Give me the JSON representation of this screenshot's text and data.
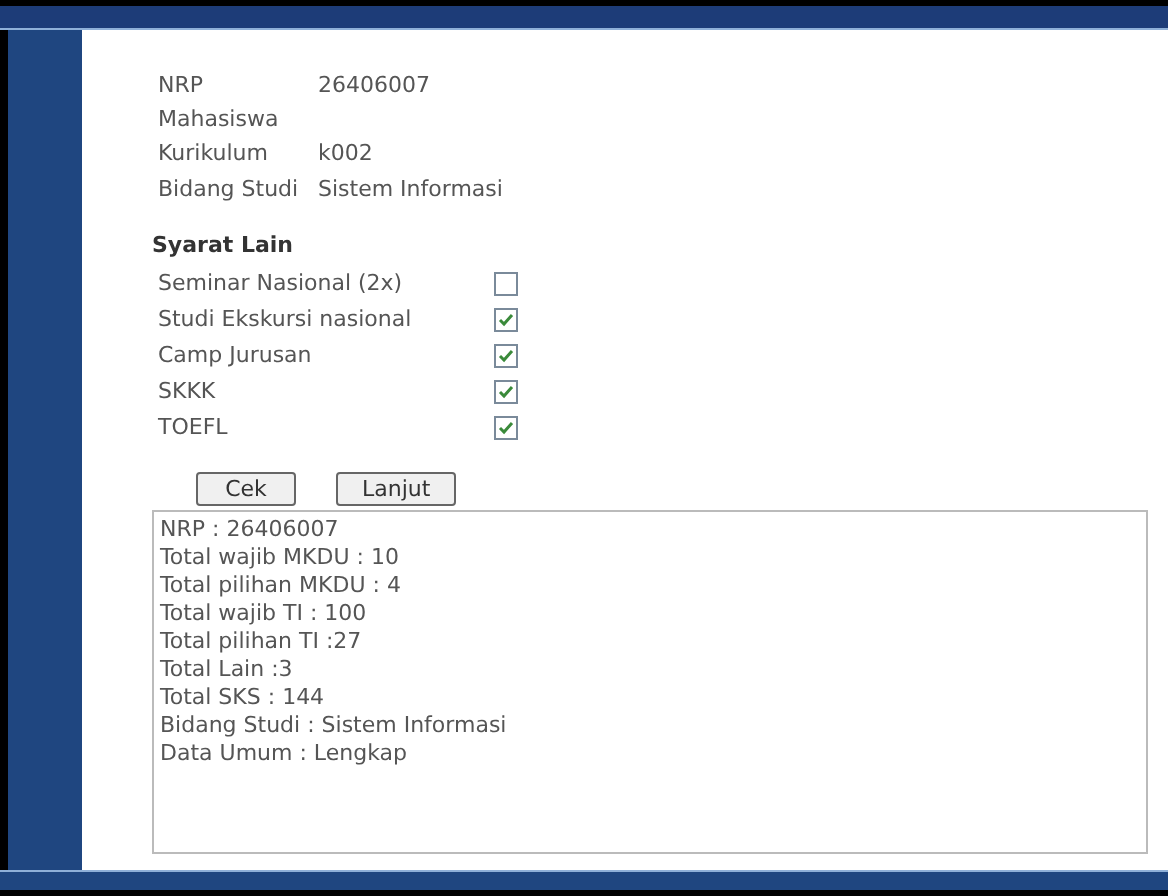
{
  "info": [
    {
      "label": "NRP Mahasiswa",
      "value": "26406007"
    },
    {
      "label": "Kurikulum",
      "value": "k002"
    },
    {
      "label": "Bidang Studi",
      "value": "Sistem Informasi"
    }
  ],
  "syarat": {
    "title": "Syarat Lain",
    "items": [
      {
        "label": "Seminar Nasional (2x)",
        "checked": false
      },
      {
        "label": "Studi Ekskursi nasional",
        "checked": true
      },
      {
        "label": "Camp Jurusan",
        "checked": true
      },
      {
        "label": "SKKK",
        "checked": true
      },
      {
        "label": "TOEFL",
        "checked": true
      }
    ]
  },
  "buttons": [
    "Cek",
    "Lanjut"
  ],
  "output": [
    "NRP : 26406007",
    "Total wajib MKDU : 10",
    "Total pilihan MKDU : 4",
    "Total wajib TI : 100",
    "Total pilihan TI :27",
    "Total Lain :3",
    "Total SKS : 144",
    "Bidang Studi : Sistem Informasi",
    "Data Umum : Lengkap"
  ]
}
